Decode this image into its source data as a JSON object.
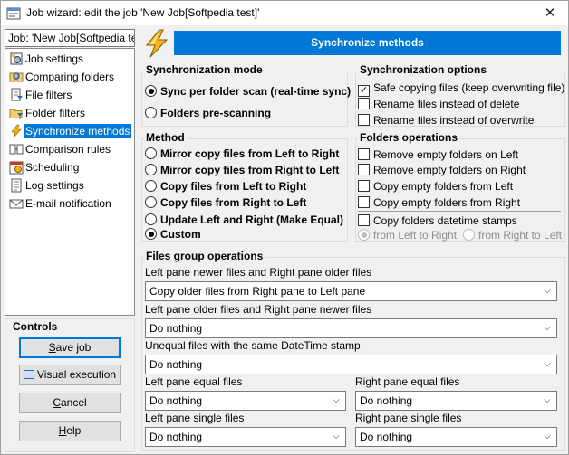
{
  "window": {
    "title": "Job wizard: edit the job 'New Job[Softpedia test]'",
    "close_glyph": "✕"
  },
  "job_field": {
    "value": "Job: 'New Job[Softpedia test]'"
  },
  "nav": {
    "items": [
      {
        "label": "Job settings",
        "icon": "settings-icon"
      },
      {
        "label": "Comparing folders",
        "icon": "compare-folders-icon"
      },
      {
        "label": "File filters",
        "icon": "file-filter-icon"
      },
      {
        "label": "Folder filters",
        "icon": "folder-filter-icon"
      },
      {
        "label": "Synchronize methods",
        "icon": "sync-icon",
        "selected": true
      },
      {
        "label": "Comparison rules",
        "icon": "rules-icon"
      },
      {
        "label": "Scheduling",
        "icon": "calendar-icon"
      },
      {
        "label": "Log settings",
        "icon": "log-icon"
      },
      {
        "label": "E-mail notification",
        "icon": "email-icon"
      }
    ]
  },
  "controls": {
    "title": "Controls",
    "save_u": "S",
    "save_rest": "ave job",
    "visual_label": "Visual execution",
    "cancel_u": "C",
    "cancel_rest": "ancel",
    "help_u": "H",
    "help_rest": "elp"
  },
  "header": {
    "title": "Synchronize methods"
  },
  "sync_mode": {
    "title": "Synchronization mode",
    "options": [
      {
        "label": "Sync per folder scan (real-time sync)",
        "selected": true
      },
      {
        "label": "Folders pre-scanning",
        "selected": false
      }
    ]
  },
  "sync_options": {
    "title": "Synchronization options",
    "options": [
      {
        "label": "Safe copying files (keep overwriting file)",
        "checked": true
      },
      {
        "label": "Rename files instead of delete",
        "checked": false
      },
      {
        "label": "Rename files instead of overwrite",
        "checked": false
      }
    ]
  },
  "method": {
    "title": "Method",
    "options": [
      {
        "label": "Mirror copy files from Left to Right",
        "selected": false
      },
      {
        "label": "Mirror copy files from Right to Left",
        "selected": false
      },
      {
        "label": "Copy files from Left to Right",
        "selected": false
      },
      {
        "label": "Copy files from Right to Left",
        "selected": false
      },
      {
        "label": "Update Left and Right (Make Equal)",
        "selected": false
      },
      {
        "label": "Custom",
        "selected": true
      }
    ]
  },
  "folders_ops": {
    "title": "Folders operations",
    "options": [
      {
        "label": "Remove empty folders on Left",
        "checked": false
      },
      {
        "label": "Remove empty folders on Right",
        "checked": false
      },
      {
        "label": "Copy empty folders from Left",
        "checked": false
      },
      {
        "label": "Copy empty folders from Right",
        "checked": false
      },
      {
        "label": "Copy folders datetime stamps",
        "checked": false
      }
    ],
    "stamp_from_left": "from Left to Right",
    "stamp_from_right": "from Right to Left"
  },
  "files_group": {
    "title": "Files group operations",
    "left_newer_label": "Left pane newer files and Right pane older files",
    "left_newer_value": "Copy older files from Right pane to Left pane",
    "left_older_label": "Left pane older files and Right pane newer files",
    "left_older_value": "Do nothing",
    "unequal_label": "Unequal files with the same DateTime stamp",
    "unequal_value": "Do nothing",
    "left_equal_label": "Left pane equal files",
    "left_equal_value": "Do nothing",
    "right_equal_label": "Right pane equal files",
    "right_equal_value": "Do nothing",
    "left_single_label": "Left pane single files",
    "left_single_value": "Do nothing",
    "right_single_label": "Right pane single files",
    "right_single_value": "Do nothing",
    "arrow_glyph": "⌵"
  }
}
